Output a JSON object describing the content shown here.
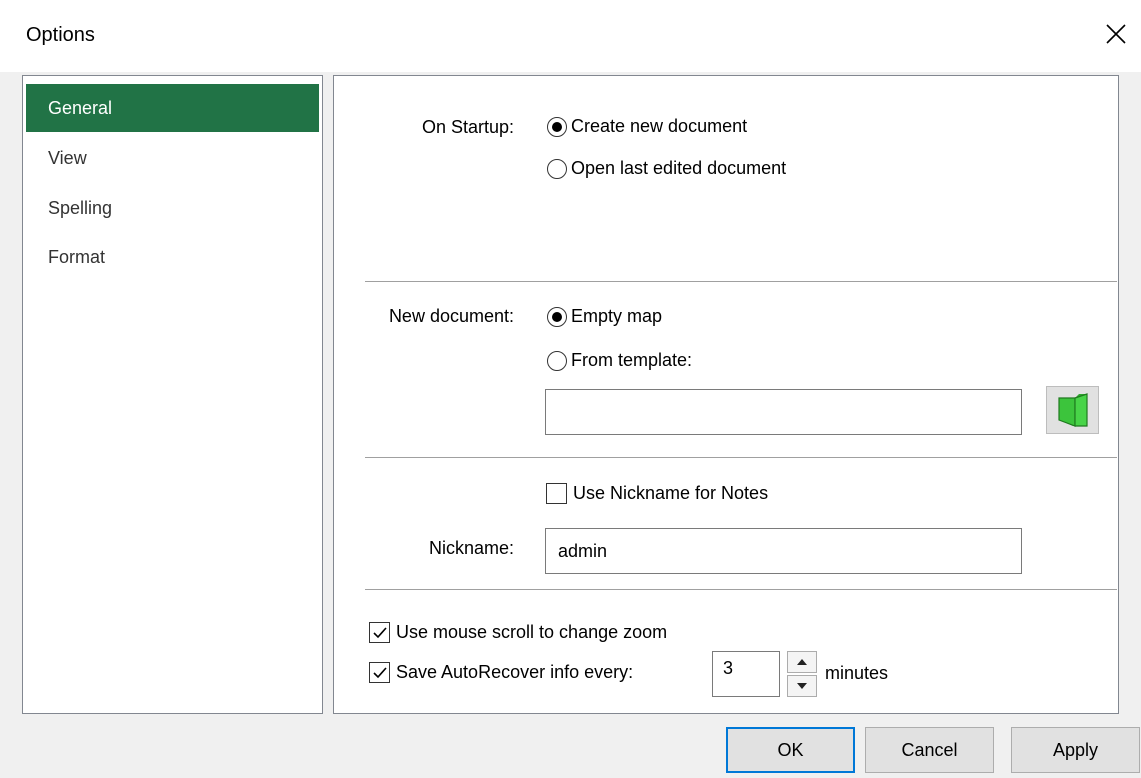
{
  "window": {
    "title": "Options"
  },
  "sidebar": {
    "items": [
      {
        "label": "General",
        "selected": true
      },
      {
        "label": "View",
        "selected": false
      },
      {
        "label": "Spelling",
        "selected": false
      },
      {
        "label": "Format",
        "selected": false
      }
    ]
  },
  "startup": {
    "label": "On Startup:",
    "options": [
      {
        "label": "Create new document",
        "selected": true
      },
      {
        "label": "Open last edited document",
        "selected": false
      }
    ]
  },
  "new_document": {
    "label": "New document:",
    "options": [
      {
        "label": "Empty map",
        "selected": true
      },
      {
        "label": "From template:",
        "selected": false
      }
    ],
    "template_path": ""
  },
  "nickname": {
    "use_for_notes_label": "Use Nickname for Notes",
    "use_for_notes_checked": false,
    "label": "Nickname:",
    "value": "admin"
  },
  "misc": {
    "mouse_scroll_label": "Use mouse scroll to change zoom",
    "mouse_scroll_checked": true,
    "autorecover_label": "Save AutoRecover info every:",
    "autorecover_checked": true,
    "autorecover_value": "3",
    "autorecover_unit": "minutes"
  },
  "buttons": {
    "ok": "OK",
    "cancel": "Cancel",
    "apply": "Apply"
  },
  "colors": {
    "accent": "#217346",
    "default_button_border": "#0078d7",
    "folder_icon": "#3cc43c"
  }
}
